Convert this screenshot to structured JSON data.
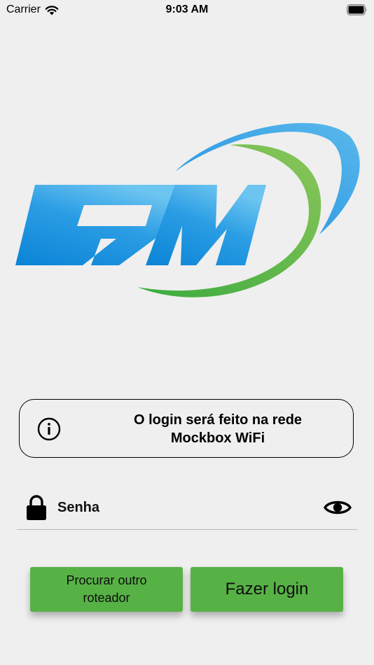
{
  "status_bar": {
    "carrier": "Carrier",
    "time": "9:03 AM"
  },
  "info": {
    "line1": "O login será feito na rede",
    "line2": "Mockbox WiFi"
  },
  "password": {
    "placeholder": "Senha",
    "value": ""
  },
  "buttons": {
    "secondary_line1": "Procurar outro",
    "secondary_line2": "roteador",
    "primary": "Fazer login"
  },
  "colors": {
    "background": "#efefef",
    "button_green": "#57b246",
    "logo_blue": "#1f96dd",
    "logo_green": "#52b447"
  },
  "icons": [
    "wifi-icon",
    "battery-icon",
    "info-icon",
    "lock-icon",
    "eye-icon"
  ]
}
